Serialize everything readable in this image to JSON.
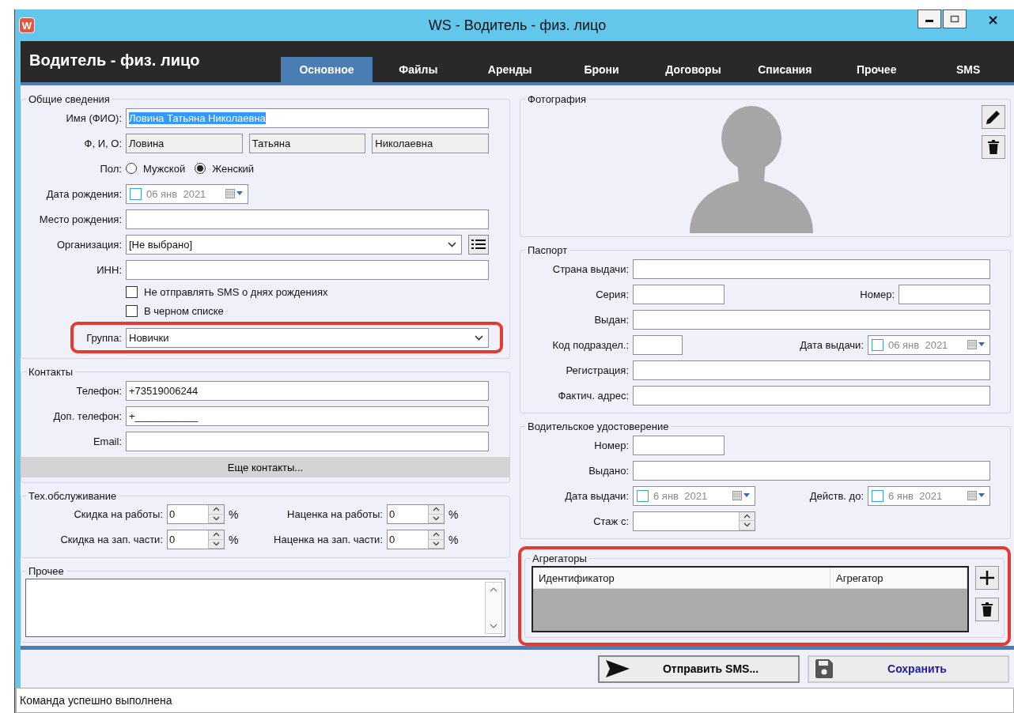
{
  "window": {
    "title": "WS - Водитель - физ. лицо",
    "logo": "W"
  },
  "header": {
    "title": "Водитель - физ. лицо"
  },
  "tabs": [
    {
      "label": "Основное",
      "selected": true
    },
    {
      "label": "Файлы",
      "selected": false
    },
    {
      "label": "Аренды",
      "selected": false
    },
    {
      "label": "Брони",
      "selected": false
    },
    {
      "label": "Договоры",
      "selected": false
    },
    {
      "label": "Списания",
      "selected": false
    },
    {
      "label": "Прочее",
      "selected": false
    },
    {
      "label": "SMS",
      "selected": false
    }
  ],
  "general": {
    "legend": "Общие сведения",
    "rows": [
      {
        "kind": "text",
        "label": "Имя (ФИО):",
        "value": "Ловина Татьяна Николаевна",
        "text_selected": true,
        "highlighted": false
      },
      {
        "kind": "split",
        "label": "Ф, И, О:",
        "values": [
          "Ловина",
          "Татьяна",
          "Николаевна"
        ],
        "highlighted": false
      },
      {
        "kind": "radio",
        "label": "Пол:",
        "options": [
          {
            "label": "Мужской",
            "selected": false
          },
          {
            "label": "Женский",
            "selected": true
          }
        ],
        "highlighted": false
      },
      {
        "kind": "date",
        "label": "Дата рождения:",
        "value": "06 янв  2021",
        "checked": false,
        "highlighted": false
      },
      {
        "kind": "text",
        "label": "Место рождения:",
        "highlighted": false
      },
      {
        "kind": "combo",
        "label": "Организация:",
        "value": "[Не выбрано]",
        "list_button": true,
        "highlighted": false
      },
      {
        "kind": "text",
        "label": "ИНН:",
        "highlighted": false
      },
      {
        "kind": "checkbox",
        "label": "Не отправлять SMS о днях рождениях",
        "checked": false,
        "highlighted": false
      },
      {
        "kind": "checkbox",
        "label": "В черном списке",
        "checked": false,
        "highlighted": false
      },
      {
        "kind": "combo",
        "label": "Группа:",
        "value": "Новички",
        "list_button": false,
        "highlighted": true
      }
    ]
  },
  "contacts": {
    "legend": "Контакты",
    "rows": [
      {
        "kind": "text",
        "label": "Телефон:",
        "value": "+73519006244"
      },
      {
        "kind": "text",
        "label": "Доп. телефон:",
        "value": "+___________"
      },
      {
        "kind": "text",
        "label": "Email:"
      }
    ],
    "more_button": "Еще контакты..."
  },
  "service": {
    "legend": "Тех.обслуживание",
    "fields": [
      {
        "label": "Скидка на работы:",
        "value": "0",
        "unit": "%"
      },
      {
        "label": "Наценка на работы:",
        "value": "0",
        "unit": "%"
      },
      {
        "label": "Скидка на зап. части:",
        "value": "0",
        "unit": "%"
      },
      {
        "label": "Наценка на зап. части:",
        "value": "0",
        "unit": "%"
      }
    ]
  },
  "other": {
    "legend": "Прочее"
  },
  "photo": {
    "legend": "Фотография"
  },
  "passport": {
    "legend": "Паспорт",
    "rows": [
      {
        "kind": "text",
        "label": "Страна выдачи:"
      },
      {
        "kind": "pair",
        "items": [
          {
            "kind": "short",
            "label": "Серия:"
          },
          {
            "kind": "short",
            "label": "Номер:"
          }
        ]
      },
      {
        "kind": "text",
        "label": "Выдан:"
      },
      {
        "kind": "pair",
        "items": [
          {
            "kind": "code",
            "label": "Код подраздел.:"
          },
          {
            "kind": "date",
            "label": "Дата выдачи:",
            "value": "06 янв  2021",
            "checked": false
          }
        ]
      },
      {
        "kind": "text",
        "label": "Регистрация:"
      },
      {
        "kind": "text",
        "label": "Фактич. адрес:"
      }
    ]
  },
  "license": {
    "legend": "Водительское удостоверение",
    "rows": [
      {
        "kind": "short",
        "label": "Номер:"
      },
      {
        "kind": "text",
        "label": "Выдано:"
      },
      {
        "kind": "pair",
        "items": [
          {
            "kind": "date",
            "label": "Дата выдачи:",
            "value": "6 янв  2021",
            "checked": false
          },
          {
            "kind": "date",
            "label": "Действ. до:",
            "value": "6 янв  2021",
            "checked": false
          }
        ]
      },
      {
        "kind": "spin",
        "label": "Стаж с:"
      }
    ]
  },
  "aggregators": {
    "legend": "Агрегаторы",
    "highlighted": true,
    "columns": [
      "Идентификатор",
      "Агрегатор"
    ]
  },
  "actions": [
    {
      "kind": "send",
      "label": "Отправить SMS..."
    },
    {
      "kind": "save",
      "label": "Сохранить"
    }
  ],
  "status_bar": "Команда успешно выполнена"
}
